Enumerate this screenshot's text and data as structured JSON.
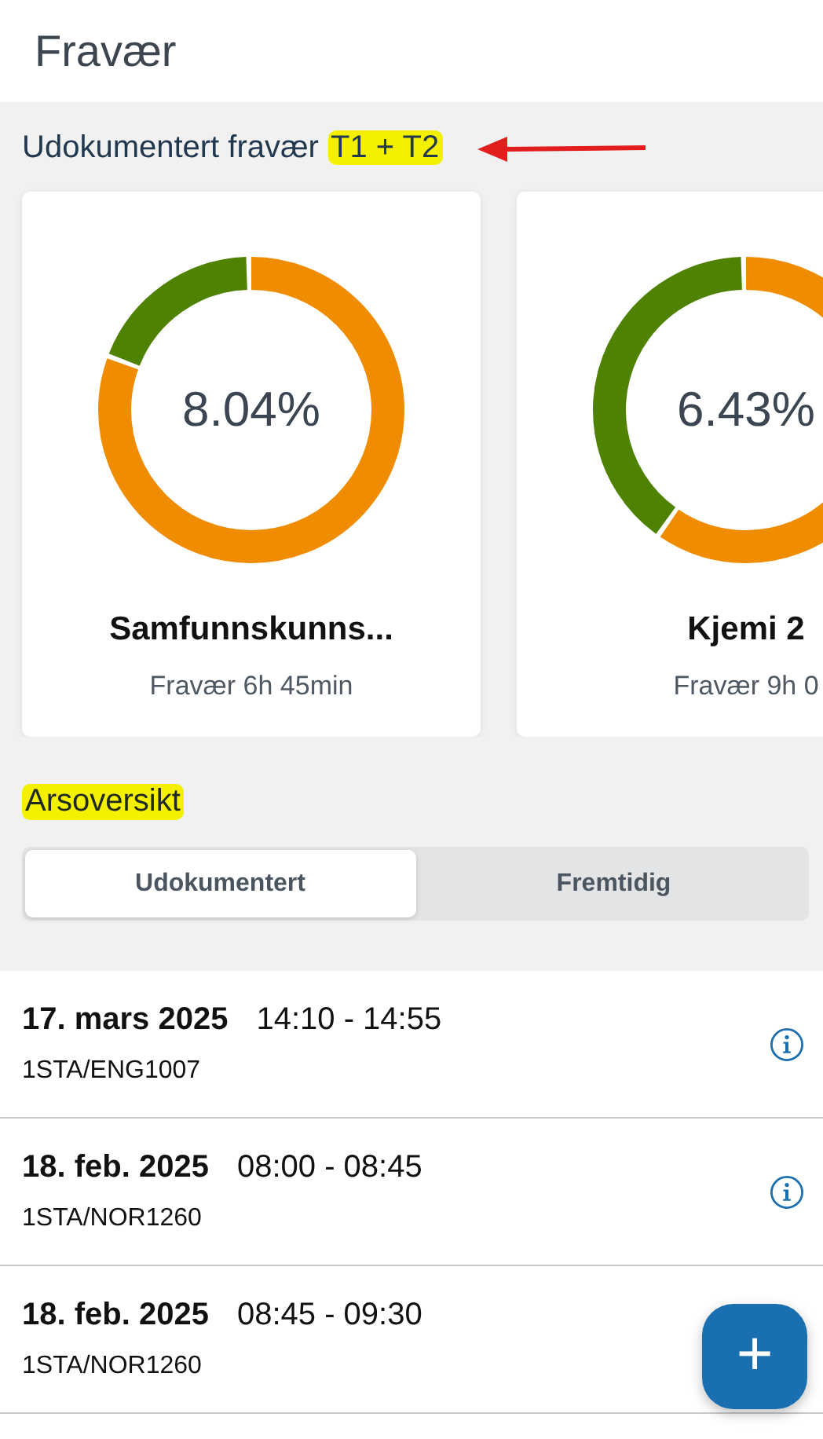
{
  "header": {
    "title": "Fravær"
  },
  "summary": {
    "heading": "Udokumentert fravær",
    "heading_highlight": "T1 + T2",
    "annotation_arrow": true
  },
  "cards": [
    {
      "percent": "8.04%",
      "subject": "Samfunnskunns...",
      "absence": "Fravær 6h 45min",
      "level": 0.19
    },
    {
      "percent": "6.43%",
      "subject": "Kjemi 2",
      "absence": "Fravær 9h 0",
      "level": 0.4
    }
  ],
  "overview": {
    "title": "Arsoversikt",
    "highlighted": true
  },
  "tabs": [
    {
      "label": "Udokumentert",
      "selected": true
    },
    {
      "label": "Fremtidig",
      "selected": false
    }
  ],
  "rows": [
    {
      "date": "17. mars 2025",
      "time": "14:10 - 14:55",
      "course": "1STA/ENG1007",
      "info": true
    },
    {
      "date": "18. feb. 2025",
      "time": "08:00 - 08:45",
      "course": "1STA/NOR1260",
      "info": true
    },
    {
      "date": "18. feb. 2025",
      "time": "08:45 - 09:30",
      "course": "1STA/NOR1260",
      "info": false
    }
  ],
  "fab": {
    "symbol": "+"
  }
}
